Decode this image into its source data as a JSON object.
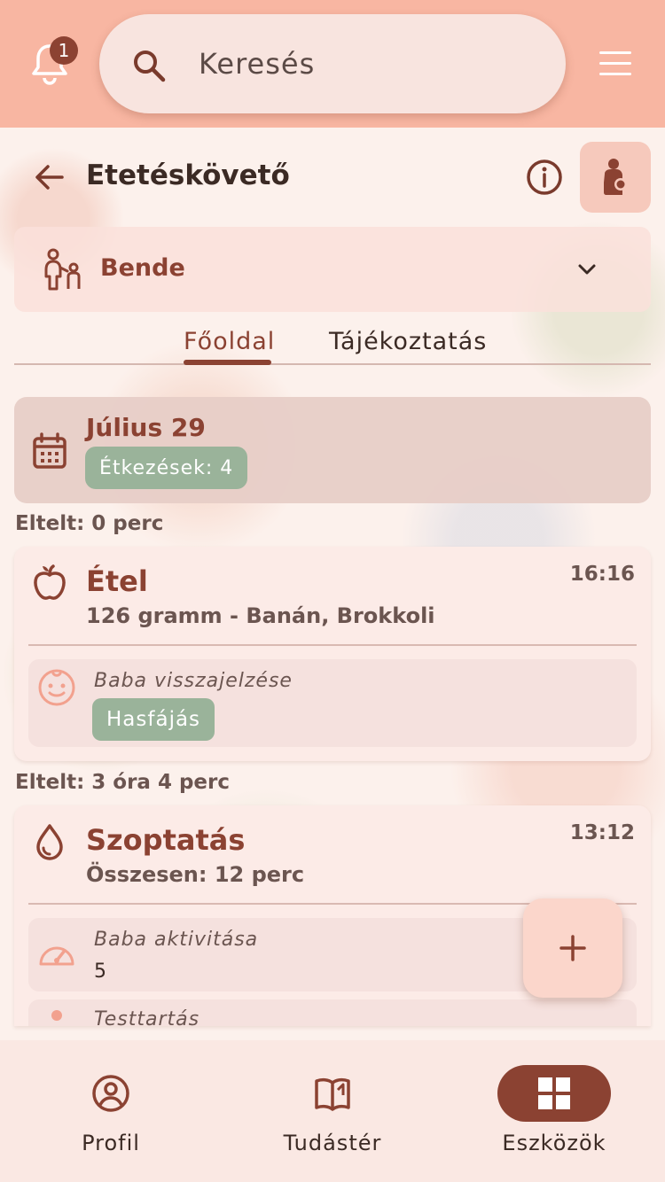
{
  "topbar": {
    "notification_count": "1",
    "search_placeholder": "Keresés"
  },
  "header": {
    "title": "Etetéskövető"
  },
  "child_selector": {
    "name": "Bende"
  },
  "tabs": [
    {
      "label": "Főoldal",
      "active": true
    },
    {
      "label": "Tájékoztatás",
      "active": false
    }
  ],
  "date_card": {
    "date": "Július 29",
    "meals_badge": "Étkezések: 4"
  },
  "entries": [
    {
      "elapsed": "Eltelt: 0 perc",
      "title": "Étel",
      "subtitle": "126 gramm - Banán, Brokkoli",
      "time": "16:16",
      "feedback_label": "Baba visszajelzése",
      "feedback_chip": "Hasfájás"
    },
    {
      "elapsed": "Eltelt: 3 óra 4 perc",
      "title": "Szoptatás",
      "subtitle": "Összesen: 12 perc",
      "time": "13:12",
      "activity_label": "Baba aktivitása",
      "activity_value": "5",
      "posture_label": "Testtartás"
    }
  ],
  "fab": {
    "icon": "plus-icon"
  },
  "bottom_nav": [
    {
      "label": "Profil",
      "icon": "profile-icon",
      "active": false
    },
    {
      "label": "Tudástér",
      "icon": "book-icon",
      "active": false
    },
    {
      "label": "Eszközök",
      "icon": "grid-icon",
      "active": true
    }
  ],
  "colors": {
    "topbar": "#f8b6a2",
    "accent": "#8b4232",
    "chip_green": "#9ab39a"
  }
}
